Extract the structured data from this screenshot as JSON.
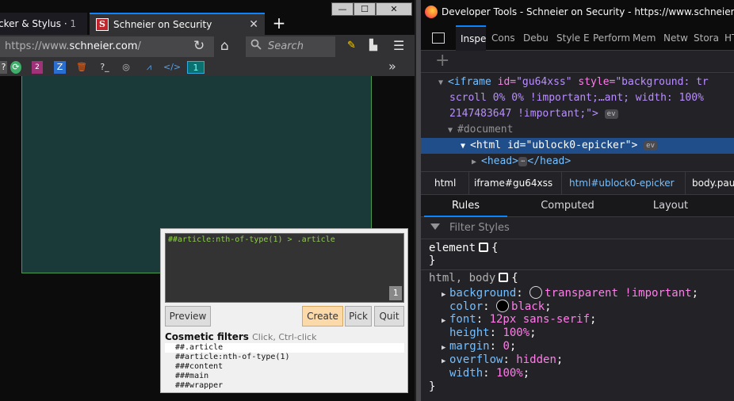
{
  "browser": {
    "tabs": [
      {
        "label": "cker & Stylus · 1"
      },
      {
        "label": "Schneier on Security",
        "favicon_letter": "S"
      }
    ],
    "new_tab_label": "+",
    "window_buttons": {
      "minimize": "—",
      "maximize": "☐",
      "close": "✕"
    },
    "url_prefix": "https://www.",
    "url_host": "schneier.com",
    "url_suffix": "/",
    "search_placeholder": "Search",
    "bookmarks": [
      "?",
      "2",
      "?_",
      "</>",
      "1"
    ],
    "overflow": "»"
  },
  "picker": {
    "filter_text": "##article:nth-of-type(1) > .article",
    "match_count": "1",
    "buttons": {
      "preview": "Preview",
      "create": "Create",
      "pick": "Pick",
      "quit": "Quit"
    },
    "cosmetic_title": "Cosmetic filters",
    "cosmetic_hint": "Click, Ctrl-click",
    "cosmetic_filters": [
      "##.article",
      "##article:nth-of-type(1)",
      "###content",
      "###main",
      "###wrapper"
    ]
  },
  "devtools": {
    "title": "Developer Tools - Schneier on Security - https://www.schneier.com/",
    "tabs": [
      "Inspe",
      "Cons",
      "Debu",
      "Style E",
      "Perform",
      "Mem",
      "Netw",
      "Stora",
      "HT"
    ],
    "markup": {
      "line1_tag": "<iframe",
      "line1_attr1": "id=",
      "line1_val1": "\"gu64xss\"",
      "line1_attr2": "style=",
      "line1_val2": "\"background: tr",
      "line2": "scroll 0% 0% !important;…ant; width: 100%",
      "line3": "2147483647 !important;\">",
      "line4": "#document",
      "line5_tag": "<html",
      "line5_attr": "id=",
      "line5_val": "\"ublock0-epicker\"",
      "line5_close": ">",
      "line6_open": "<head>",
      "line6_ellipsis": "⋯",
      "line6_close": "</head>",
      "ev_label": "ev"
    },
    "breadcrumbs": [
      "html",
      "iframe#gu64xss",
      "html#ublock0-epicker",
      "body.pau"
    ],
    "rule_tabs": [
      "Rules",
      "Computed",
      "Layout"
    ],
    "filter_placeholder": "Filter Styles",
    "rules": {
      "element_selector": "element",
      "open_brace": "{",
      "close_brace": "}",
      "html_selector": "html, body",
      "declarations": [
        {
          "prop": "background",
          "value": "transparent !important",
          "swatch": "transparent"
        },
        {
          "prop": "color",
          "value": "black",
          "swatch": "#000000"
        },
        {
          "prop": "font",
          "value": "12px sans-serif"
        },
        {
          "prop": "height",
          "value": "100%"
        },
        {
          "prop": "margin",
          "value": "0"
        },
        {
          "prop": "overflow",
          "value": "hidden"
        },
        {
          "prop": "width",
          "value": "100%"
        }
      ]
    }
  }
}
